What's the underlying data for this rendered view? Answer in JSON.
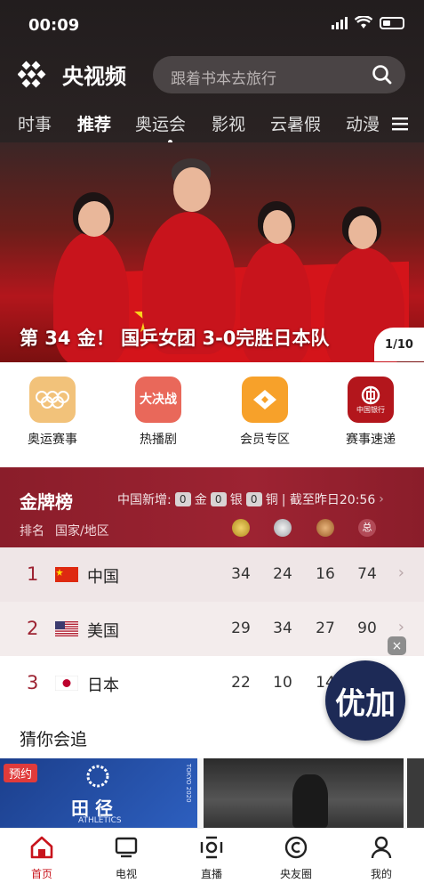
{
  "status": {
    "time": "00:09"
  },
  "header": {
    "app_name": "央视频",
    "search_placeholder": "跟着书本去旅行"
  },
  "tabs": [
    {
      "label": "时事"
    },
    {
      "label": "推荐",
      "active": true
    },
    {
      "label": "奥运会"
    },
    {
      "label": "影视"
    },
    {
      "label": "云暑假"
    },
    {
      "label": "动漫"
    }
  ],
  "banner": {
    "caption": "第 34 金！ 国乒女团 3-0完胜日本队",
    "page_indicator": "1/10"
  },
  "quick_links": [
    {
      "label": "奥运赛事",
      "icon": "olympic-rings-icon",
      "color": "#f2c27a"
    },
    {
      "label": "热播剧",
      "icon": "hot-drama-icon",
      "color": "#e9685a",
      "icon_text": "大决战"
    },
    {
      "label": "会员专区",
      "icon": "vip-icon",
      "color": "#f7a12a"
    },
    {
      "label": "赛事速递",
      "icon": "bank-of-china-icon",
      "color": "#b3161c",
      "icon_text": "中国银行"
    }
  ],
  "medal": {
    "title": "金牌榜",
    "new_prefix": "中国新增:",
    "gold_new": "0",
    "gold_label": "金",
    "silver_new": "0",
    "silver_label": "银",
    "bronze_new": "0",
    "bronze_label": "铜",
    "cutoff": "| 截至昨日20:56",
    "header_rank": "排名",
    "header_country": "国家/地区",
    "total_badge": "总",
    "rows": [
      {
        "rank": "1",
        "country": "中国",
        "gold": "34",
        "silver": "24",
        "bronze": "16",
        "total": "74"
      },
      {
        "rank": "2",
        "country": "美国",
        "gold": "29",
        "silver": "34",
        "bronze": "27",
        "total": "90"
      },
      {
        "rank": "3",
        "country": "日本",
        "gold": "22",
        "silver": "10",
        "bronze": "14",
        "total": ""
      }
    ]
  },
  "guess": {
    "title": "猜你会追",
    "badge": "预约",
    "thumb1_title": "田 径",
    "thumb1_sub": "ATHLETICS",
    "thumb1_tag": "TOKYO 2020"
  },
  "floating": {
    "label": "优加",
    "close": "×"
  },
  "nav": [
    {
      "label": "首页",
      "icon": "home-icon",
      "active": true
    },
    {
      "label": "电视",
      "icon": "tv-icon"
    },
    {
      "label": "直播",
      "icon": "live-icon"
    },
    {
      "label": "央友圈",
      "icon": "community-icon"
    },
    {
      "label": "我的",
      "icon": "profile-icon"
    }
  ]
}
